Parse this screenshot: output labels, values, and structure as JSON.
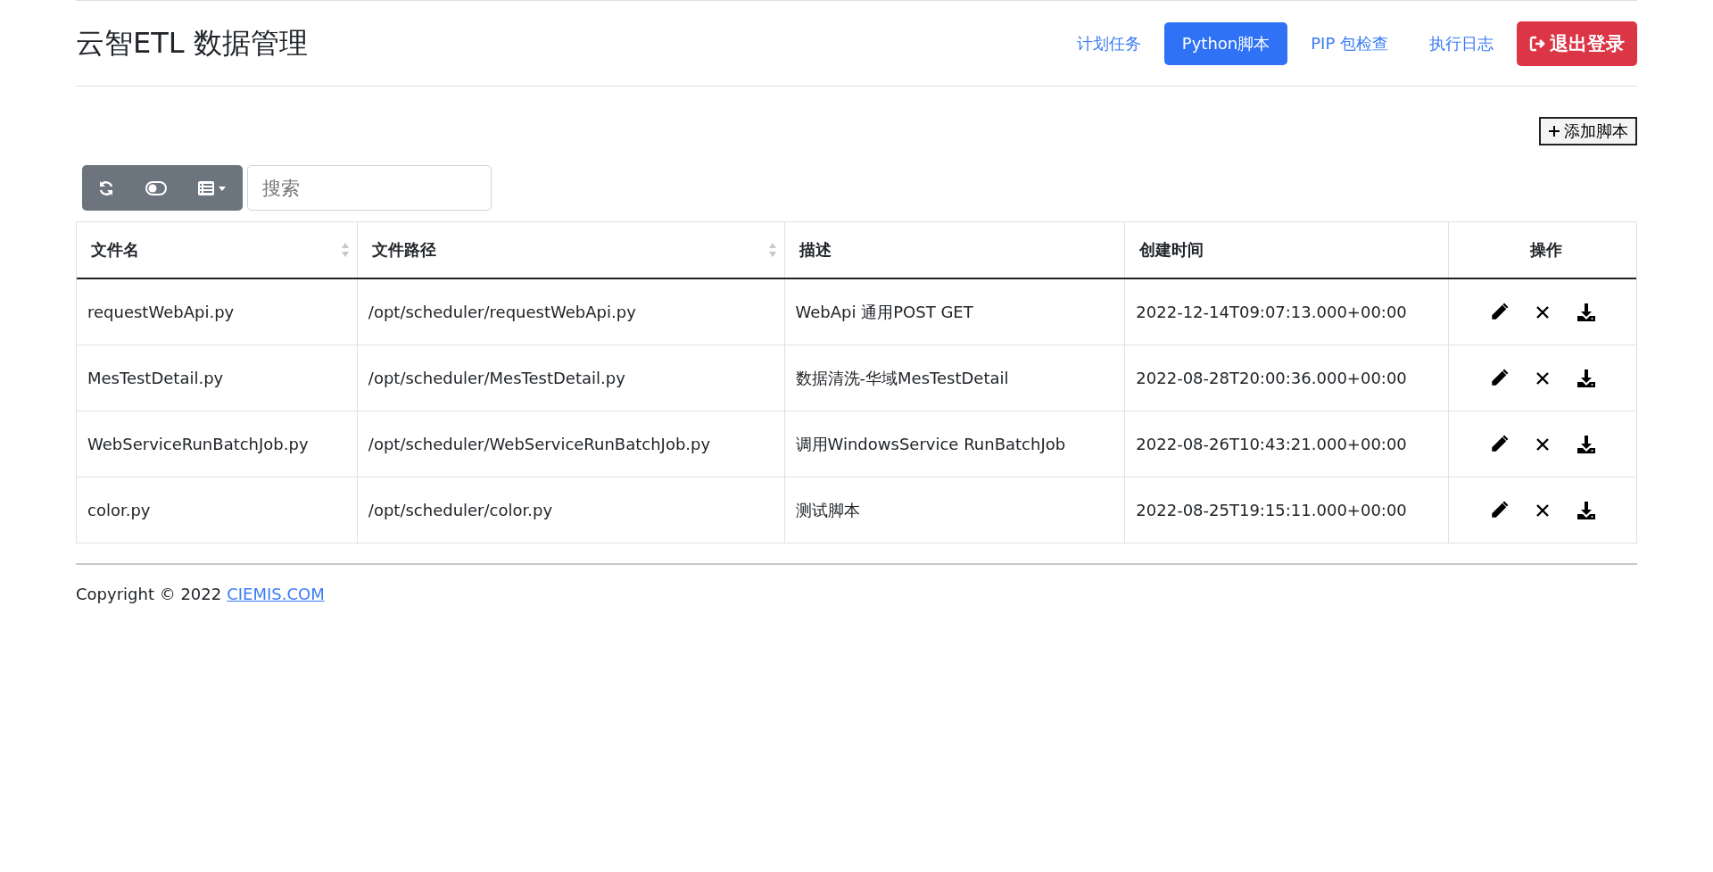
{
  "header": {
    "title": "云智ETL 数据管理",
    "nav": [
      {
        "label": "计划任务",
        "selected": false
      },
      {
        "label": "Python脚本",
        "selected": true
      },
      {
        "label": "PIP 包检查",
        "selected": false
      },
      {
        "label": "执行日志",
        "selected": false
      }
    ],
    "logout_button": "退出登录"
  },
  "add_button": "添加脚本",
  "search": {
    "placeholder": "搜索"
  },
  "table": {
    "columns": [
      {
        "label": "文件名",
        "sortable": true
      },
      {
        "label": "文件路径",
        "sortable": true
      },
      {
        "label": "描述",
        "sortable": false
      },
      {
        "label": "创建时间",
        "sortable": false
      },
      {
        "label": "操作",
        "sortable": false
      }
    ],
    "rows": [
      [
        "requestWebApi.py",
        "/opt/scheduler/requestWebApi.py",
        "WebApi 通用POST GET",
        "2022-12-14T09:07:13.000+00:00"
      ],
      [
        "MesTestDetail.py",
        "/opt/scheduler/MesTestDetail.py",
        "数据清洗-华域MesTestDetail",
        "2022-08-28T20:00:36.000+00:00"
      ],
      [
        "WebServiceRunBatchJob.py",
        "/opt/scheduler/WebServiceRunBatchJob.py",
        "调用WindowsService RunBatchJob",
        "2022-08-26T10:43:21.000+00:00"
      ],
      [
        "color.py",
        "/opt/scheduler/color.py",
        "测试脚本",
        "2022-08-25T19:15:11.000+00:00"
      ]
    ]
  },
  "footer": {
    "text": "Copyright © 2022",
    "link": "CIEMIS.COM"
  }
}
